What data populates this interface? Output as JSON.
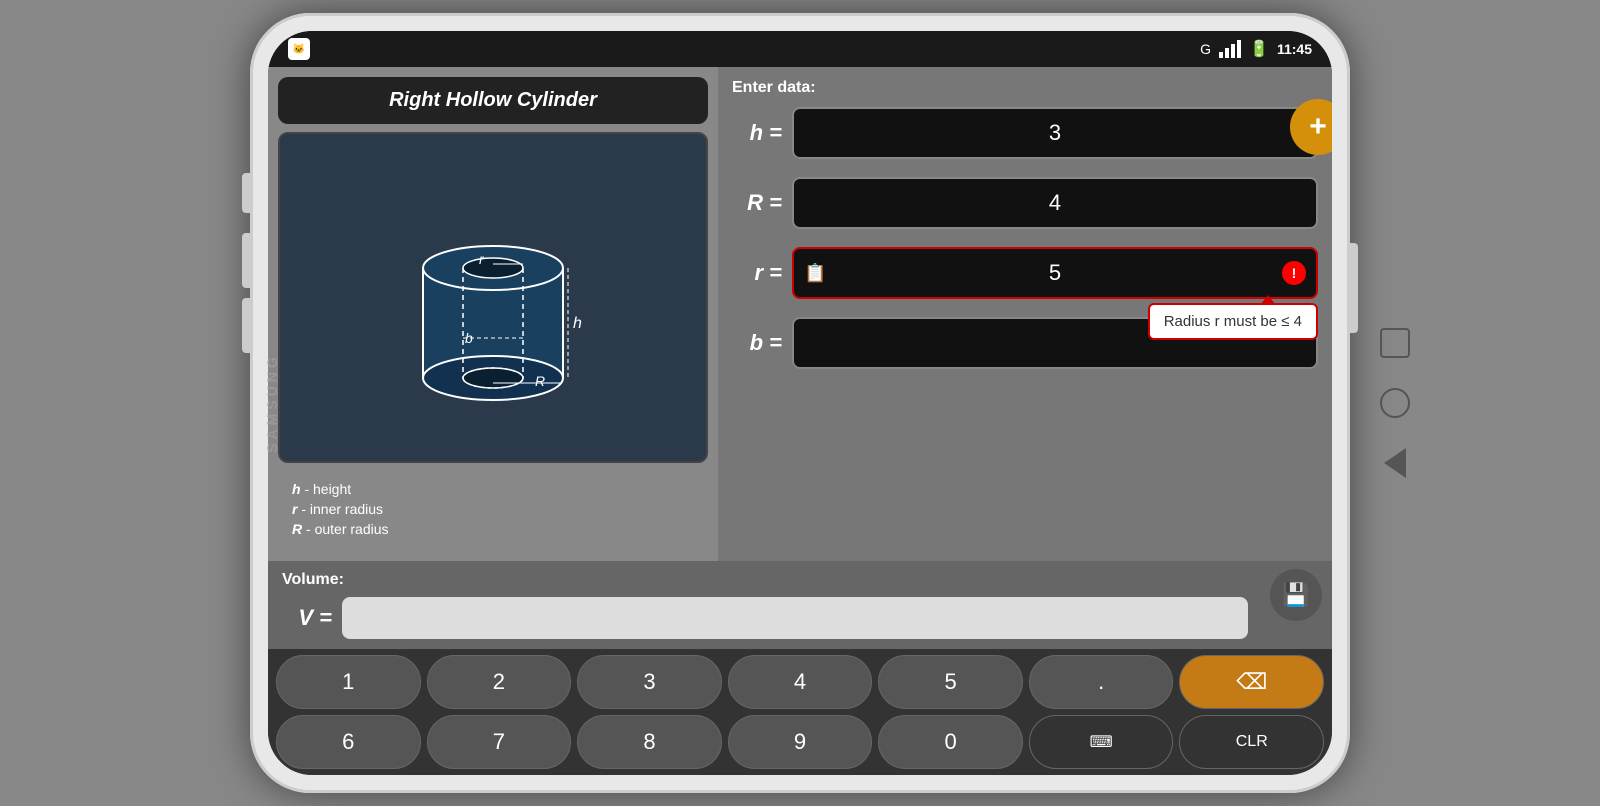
{
  "status_bar": {
    "time": "11:45",
    "app_icon": "🐱"
  },
  "shape": {
    "title": "Right Hollow Cylinder"
  },
  "enter_data": {
    "label": "Enter data:"
  },
  "inputs": {
    "h": {
      "label": "h =",
      "value": "3"
    },
    "R": {
      "label": "R =",
      "value": "4"
    },
    "r": {
      "label": "r =",
      "value": "5",
      "error": true,
      "has_clipboard": true
    },
    "b": {
      "label": "b =",
      "value": ""
    }
  },
  "tooltip": {
    "message": "Radius r must be ≤ 4"
  },
  "volume": {
    "label": "Volume:",
    "var_label": "V =",
    "value": ""
  },
  "legend": {
    "items": [
      {
        "var": "h",
        "desc": "- height"
      },
      {
        "var": "r",
        "desc": "- inner radius"
      },
      {
        "var": "R",
        "desc": "- outer radius"
      }
    ]
  },
  "keyboard": {
    "row1": [
      "1",
      "2",
      "3",
      "4",
      "5",
      ".",
      "⌫"
    ],
    "row2": [
      "6",
      "7",
      "8",
      "9",
      "0",
      "⌨",
      "CLR"
    ]
  },
  "add_button_label": "+",
  "save_icon": "💾"
}
